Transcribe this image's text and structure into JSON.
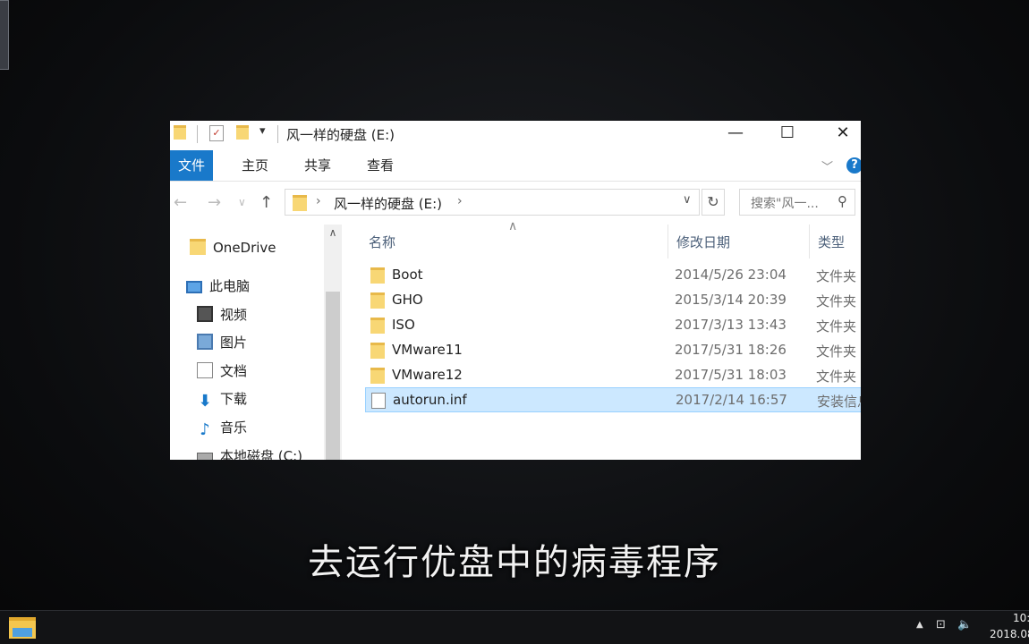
{
  "window": {
    "title": "风一样的硬盘 (E:)",
    "controls": {
      "minimize": "—",
      "maximize": "☐",
      "close": "✕"
    }
  },
  "ribbon": {
    "tabs": [
      "文件",
      "主页",
      "共享",
      "查看"
    ]
  },
  "address": {
    "path": "风一样的硬盘 (E:)",
    "search_placeholder": "搜索\"风一..."
  },
  "nav_pane": {
    "items": [
      {
        "label": "OneDrive",
        "icon": "folder-icon"
      },
      {
        "label": "此电脑",
        "icon": "computer-icon"
      },
      {
        "label": "视频",
        "icon": "video-icon"
      },
      {
        "label": "图片",
        "icon": "picture-icon"
      },
      {
        "label": "文档",
        "icon": "document-icon"
      },
      {
        "label": "下载",
        "icon": "download-icon"
      },
      {
        "label": "音乐",
        "icon": "music-icon"
      },
      {
        "label": "本地磁盘 (C:)",
        "icon": "disk-icon"
      }
    ]
  },
  "file_list": {
    "columns": [
      "名称",
      "修改日期",
      "类型"
    ],
    "rows": [
      {
        "name": "Boot",
        "date": "2014/5/26 23:04",
        "type": "文件夹",
        "kind": "folder"
      },
      {
        "name": "GHO",
        "date": "2015/3/14 20:39",
        "type": "文件夹",
        "kind": "folder"
      },
      {
        "name": "ISO",
        "date": "2017/3/13 13:43",
        "type": "文件夹",
        "kind": "folder"
      },
      {
        "name": "VMware11",
        "date": "2017/5/31 18:26",
        "type": "文件夹",
        "kind": "folder"
      },
      {
        "name": "VMware12",
        "date": "2017/5/31 18:03",
        "type": "文件夹",
        "kind": "folder"
      },
      {
        "name": "autorun.inf",
        "date": "2017/2/14 16:57",
        "type": "安装信息",
        "kind": "file",
        "selected": true
      }
    ]
  },
  "subtitle": "去运行优盘中的病毒程序",
  "taskbar": {
    "time": "10:",
    "date": "2018.08"
  }
}
